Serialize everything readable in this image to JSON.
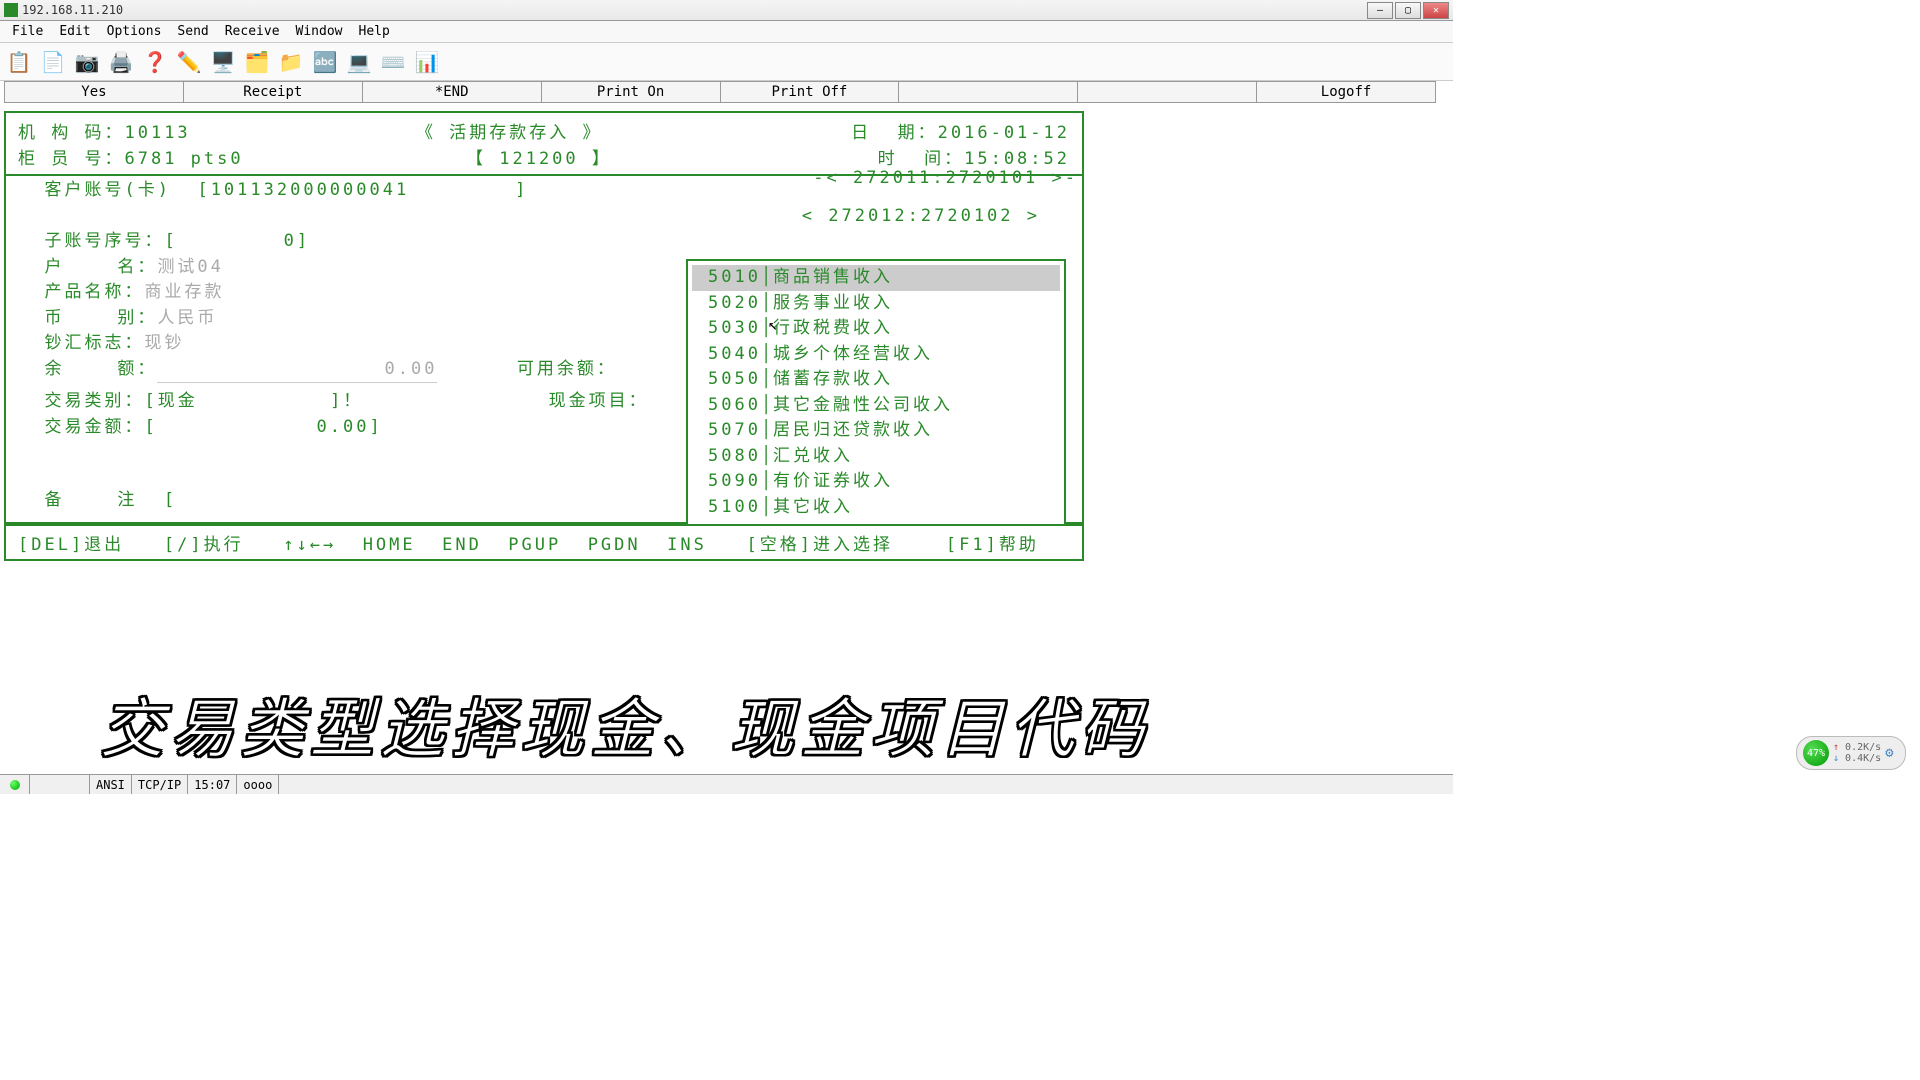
{
  "window": {
    "title": "192.168.11.210"
  },
  "menu": {
    "file": "File",
    "edit": "Edit",
    "options": "Options",
    "send": "Send",
    "receive": "Receive",
    "window": "Window",
    "help": "Help"
  },
  "actions": {
    "yes": "Yes",
    "receipt": "Receipt",
    "end": "*END",
    "print_on": "Print On",
    "print_off": "Print Off",
    "blank1": "",
    "blank2": "",
    "logoff": "Logoff"
  },
  "terminal": {
    "org_code_label": "机 构 码：",
    "org_code": "10113",
    "txn_title": "《 活期存款存入 》",
    "date_label": "日  期：",
    "date": "2016-01-12",
    "teller_label": "柜 员 号：",
    "teller": "6781 pts0",
    "txn_code": "【 121200 】",
    "time_label": "时  间：",
    "time": "15:08:52",
    "seq1": "-< 272011:2720101 >-",
    "seq2": "< 272012:2720102 >",
    "acct_label": "客户账号(卡)",
    "acct_value": "[101132000000041        ]",
    "sub_label": "子账号序号：",
    "sub_value": "[        0]",
    "name_label": "户    名：",
    "name_value": "测试04",
    "prod_label": "产品名称：",
    "prod_value": "商业存款",
    "ccy_label": "币    别：",
    "ccy_value": "人民币",
    "cash_flag_label": "钞汇标志：",
    "cash_flag_value": "现钞",
    "balance_label": "余    额：",
    "balance_value": "0.00",
    "avail_label": "可用余额：",
    "txn_type_label": "交易类别：",
    "txn_type_value": "[现金          ]！",
    "cash_item_label": "现金项目：",
    "txn_amt_label": "交易金额：",
    "txn_amt_value": "[            0.00]",
    "remark_label": "备    注",
    "remark_value": "["
  },
  "popup": {
    "items": [
      {
        "code": "5010",
        "label": "商品销售收入",
        "selected": true
      },
      {
        "code": "5020",
        "label": "服务事业收入",
        "selected": false
      },
      {
        "code": "5030",
        "label": "行政税费收入",
        "selected": false
      },
      {
        "code": "5040",
        "label": "城乡个体经营收入",
        "selected": false
      },
      {
        "code": "5050",
        "label": "储蓄存款收入",
        "selected": false
      },
      {
        "code": "5060",
        "label": "其它金融性公司收入",
        "selected": false
      },
      {
        "code": "5070",
        "label": "居民归还贷款收入",
        "selected": false
      },
      {
        "code": "5080",
        "label": "汇兑收入",
        "selected": false
      },
      {
        "code": "5090",
        "label": "有价证券收入",
        "selected": false
      },
      {
        "code": "5100",
        "label": "其它收入",
        "selected": false
      }
    ]
  },
  "footer": {
    "text": "[DEL]退出   [/]执行   ↑↓←→  HOME  END  PGUP  PGDN  INS   [空格]进入选择    [F1]帮助"
  },
  "status": {
    "mode": "ANSI",
    "proto": "TCP/IP",
    "clock": "15:07",
    "extra": "oooo"
  },
  "tray": {
    "pct": "47%",
    "up": "0.2K/s",
    "down": "0.4K/s"
  },
  "subtitle": "交易类型选择现金、现金项目代码"
}
